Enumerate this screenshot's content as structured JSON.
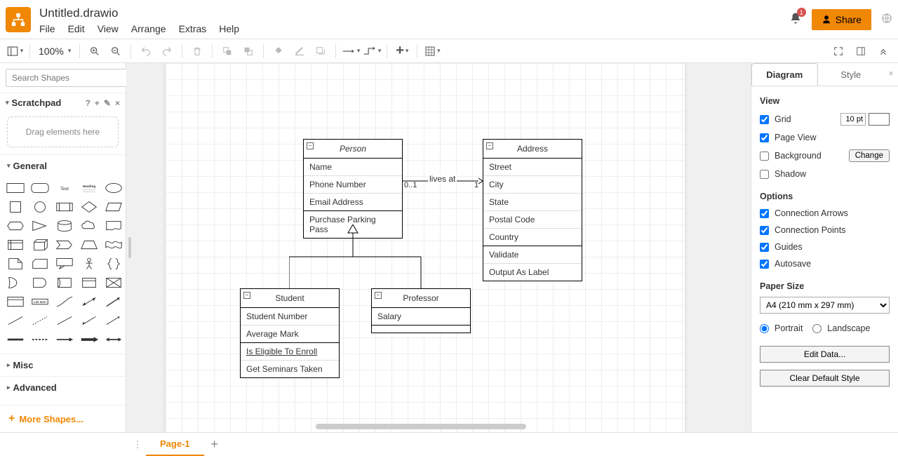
{
  "doc": {
    "title": "Untitled.drawio"
  },
  "menu": {
    "file": "File",
    "edit": "Edit",
    "view": "View",
    "arrange": "Arrange",
    "extras": "Extras",
    "help": "Help"
  },
  "top": {
    "share": "Share",
    "bell_badge": "1"
  },
  "toolbar": {
    "zoom": "100%"
  },
  "search": {
    "placeholder": "Search Shapes"
  },
  "scratchpad": {
    "title": "Scratchpad",
    "help": "?",
    "add": "+",
    "edit": "✎",
    "close": "×",
    "drop": "Drag elements here"
  },
  "sections": {
    "general": "General",
    "misc": "Misc",
    "advanced": "Advanced"
  },
  "more_shapes": "More Shapes...",
  "right": {
    "tabs": {
      "diagram": "Diagram",
      "style": "Style"
    },
    "view_heading": "View",
    "grid": "Grid",
    "grid_size": "10 pt",
    "page_view": "Page View",
    "background": "Background",
    "change": "Change",
    "shadow": "Shadow",
    "options_heading": "Options",
    "conn_arrows": "Connection Arrows",
    "conn_points": "Connection Points",
    "guides": "Guides",
    "autosave": "Autosave",
    "paper_heading": "Paper Size",
    "paper_value": "A4 (210 mm x 297 mm)",
    "portrait": "Portrait",
    "landscape": "Landscape",
    "edit_data": "Edit Data...",
    "clear_style": "Clear Default Style"
  },
  "bottom": {
    "page1": "Page-1"
  },
  "uml": {
    "person": {
      "title": "Person",
      "attrs": [
        "Name",
        "Phone Number",
        "Email Address"
      ],
      "ops": [
        "Purchase Parking Pass"
      ]
    },
    "address": {
      "title": "Address",
      "attrs": [
        "Street",
        "City",
        "State",
        "Postal Code",
        "Country"
      ],
      "ops": [
        "Validate",
        "Output As Label"
      ]
    },
    "student": {
      "title": "Student",
      "attrs": [
        "Student Number",
        "Average Mark"
      ],
      "ops": [
        "Is Eligible To Enroll",
        "Get Seminars Taken"
      ]
    },
    "professor": {
      "title": "Professor",
      "attrs": [
        "Salary"
      ]
    },
    "rel": {
      "lives": "lives at",
      "card_left": "0..1",
      "card_right": "1"
    }
  }
}
